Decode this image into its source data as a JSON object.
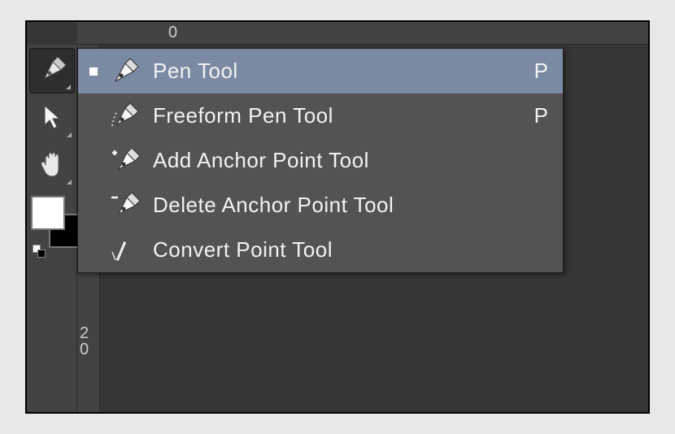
{
  "ruler": {
    "top_labels": [
      {
        "text": "0",
        "pos": 112
      }
    ],
    "left_labels": [
      {
        "text": "2",
        "pos": 345
      },
      {
        "text": "0",
        "pos": 365
      }
    ]
  },
  "toolbar": {
    "tools": [
      {
        "name": "pen-tool",
        "active": true
      },
      {
        "name": "direct-selection-tool",
        "active": false
      },
      {
        "name": "hand-tool",
        "active": false
      }
    ],
    "fg_color": "#ffffff",
    "bg_color": "#000000"
  },
  "flyout": {
    "items": [
      {
        "label": "Pen Tool",
        "shortcut": "P",
        "icon": "pen-icon",
        "selected": true
      },
      {
        "label": "Freeform Pen Tool",
        "shortcut": "P",
        "icon": "freeform-pen-icon",
        "selected": false
      },
      {
        "label": "Add Anchor Point Tool",
        "shortcut": "",
        "icon": "add-anchor-icon",
        "selected": false
      },
      {
        "label": "Delete Anchor Point Tool",
        "shortcut": "",
        "icon": "delete-anchor-icon",
        "selected": false
      },
      {
        "label": "Convert Point Tool",
        "shortcut": "",
        "icon": "convert-point-icon",
        "selected": false
      }
    ]
  }
}
